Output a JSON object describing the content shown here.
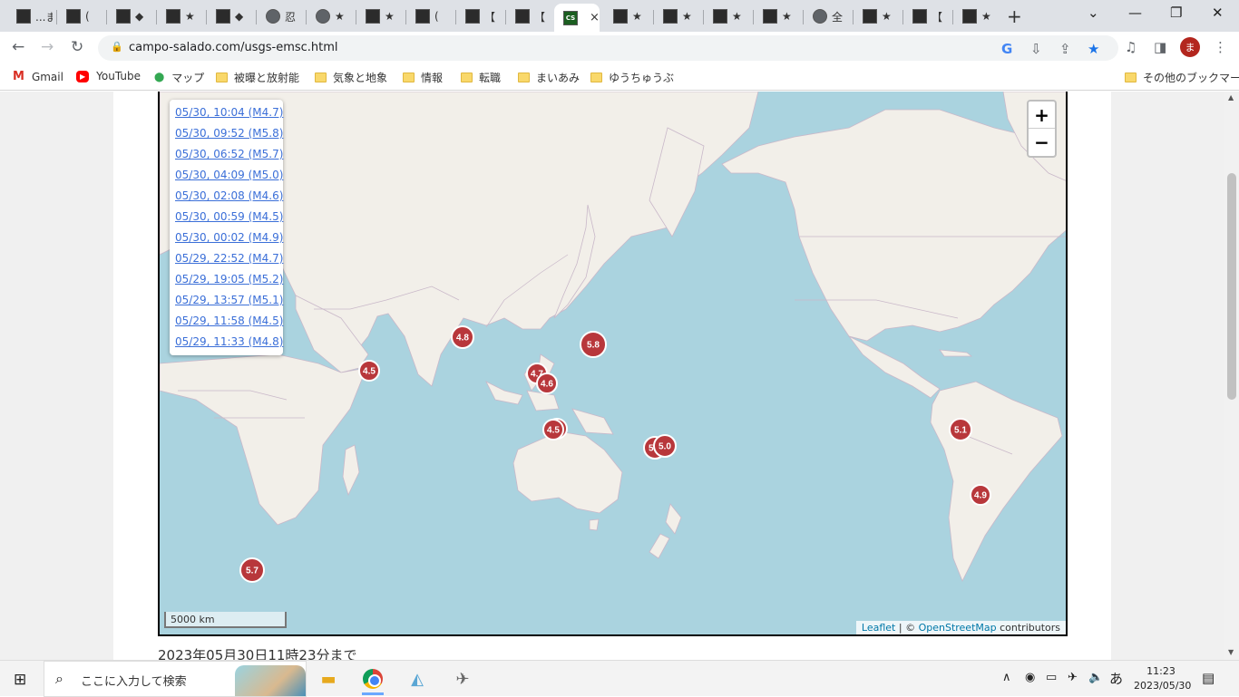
{
  "browser": {
    "tabs": [
      {
        "icon": "site-favicon",
        "title": "...ま"
      },
      {
        "icon": "site-favicon",
        "title": "("
      },
      {
        "icon": "site-favicon",
        "title": "◆"
      },
      {
        "icon": "site-favicon",
        "title": "★"
      },
      {
        "icon": "site-favicon",
        "title": "◆"
      },
      {
        "icon": "globe-icon",
        "title": "忍"
      },
      {
        "icon": "globe-icon",
        "title": "★"
      },
      {
        "icon": "site-favicon",
        "title": "★"
      },
      {
        "icon": "site-favicon",
        "title": "("
      },
      {
        "icon": "site-favicon",
        "title": "【"
      },
      {
        "icon": "site-favicon",
        "title": "【"
      },
      {
        "icon": "cs-favicon",
        "title": "CS",
        "active": true
      },
      {
        "icon": "site-favicon",
        "title": "★"
      },
      {
        "icon": "site-favicon",
        "title": "★"
      },
      {
        "icon": "site-favicon",
        "title": "★"
      },
      {
        "icon": "site-favicon",
        "title": "★"
      },
      {
        "icon": "globe-icon",
        "title": "全"
      },
      {
        "icon": "site-favicon",
        "title": "★"
      },
      {
        "icon": "site-favicon",
        "title": "【"
      },
      {
        "icon": "site-favicon",
        "title": "★"
      }
    ],
    "close_tab_glyph": "×",
    "new_tab_glyph": "+",
    "url": "campo-salado.com/usgs-emsc.html",
    "avatar_initial": "ま",
    "bookmarks": [
      {
        "label": "Gmail",
        "icon": "gmail-icon"
      },
      {
        "label": "YouTube",
        "icon": "youtube-icon"
      },
      {
        "label": "マップ",
        "icon": "maps-pin-icon"
      },
      {
        "label": "被曝と放射能",
        "icon": "folder-icon"
      },
      {
        "label": "気象と地象",
        "icon": "folder-icon"
      },
      {
        "label": "情報",
        "icon": "folder-icon"
      },
      {
        "label": "転職",
        "icon": "folder-icon"
      },
      {
        "label": "まいあみ",
        "icon": "folder-icon"
      },
      {
        "label": "ゆうちゅうぶ",
        "icon": "folder-icon"
      }
    ],
    "other_bookmarks": "その他のブックマーク"
  },
  "map": {
    "earthquake_list": [
      "05/30, 10:04 (M4.7)",
      "05/30, 09:52 (M5.8)",
      "05/30, 06:52 (M5.7)",
      "05/30, 04:09 (M5.0)",
      "05/30, 02:08 (M4.6)",
      "05/30, 00:59 (M4.5)",
      "05/30, 00:02 (M4.9)",
      "05/29, 22:52 (M4.7)",
      "05/29, 19:05 (M5.2)",
      "05/29, 13:57 (M5.1)",
      "05/29, 11:58 (M4.5)",
      "05/29, 11:33 (M4.8)"
    ],
    "markers": [
      {
        "label": "4.8"
      },
      {
        "label": "5.8"
      },
      {
        "label": "4.5"
      },
      {
        "label": "4.7"
      },
      {
        "label": "4.6"
      },
      {
        "label": "4.7"
      },
      {
        "label": "4.5"
      },
      {
        "label": "5.2"
      },
      {
        "label": "5.0"
      },
      {
        "label": "5.1"
      },
      {
        "label": "4.9"
      },
      {
        "label": "5.7"
      }
    ],
    "marker_color": "#b8373b",
    "zoom_in": "+",
    "zoom_out": "−",
    "scale_label": "5000 km",
    "attribution_leaflet": "Leaflet",
    "attribution_sep": " | © ",
    "attribution_osm": "OpenStreetMap",
    "attribution_tail": " contributors",
    "ocean_color": "#aad3df",
    "land_color": "#f2efe9"
  },
  "footer_text": "2023年05月30日11時23分まで",
  "taskbar": {
    "search_placeholder": "ここに入力して検索",
    "time": "11:23",
    "date": "2023/05/30",
    "ime": "あ"
  }
}
